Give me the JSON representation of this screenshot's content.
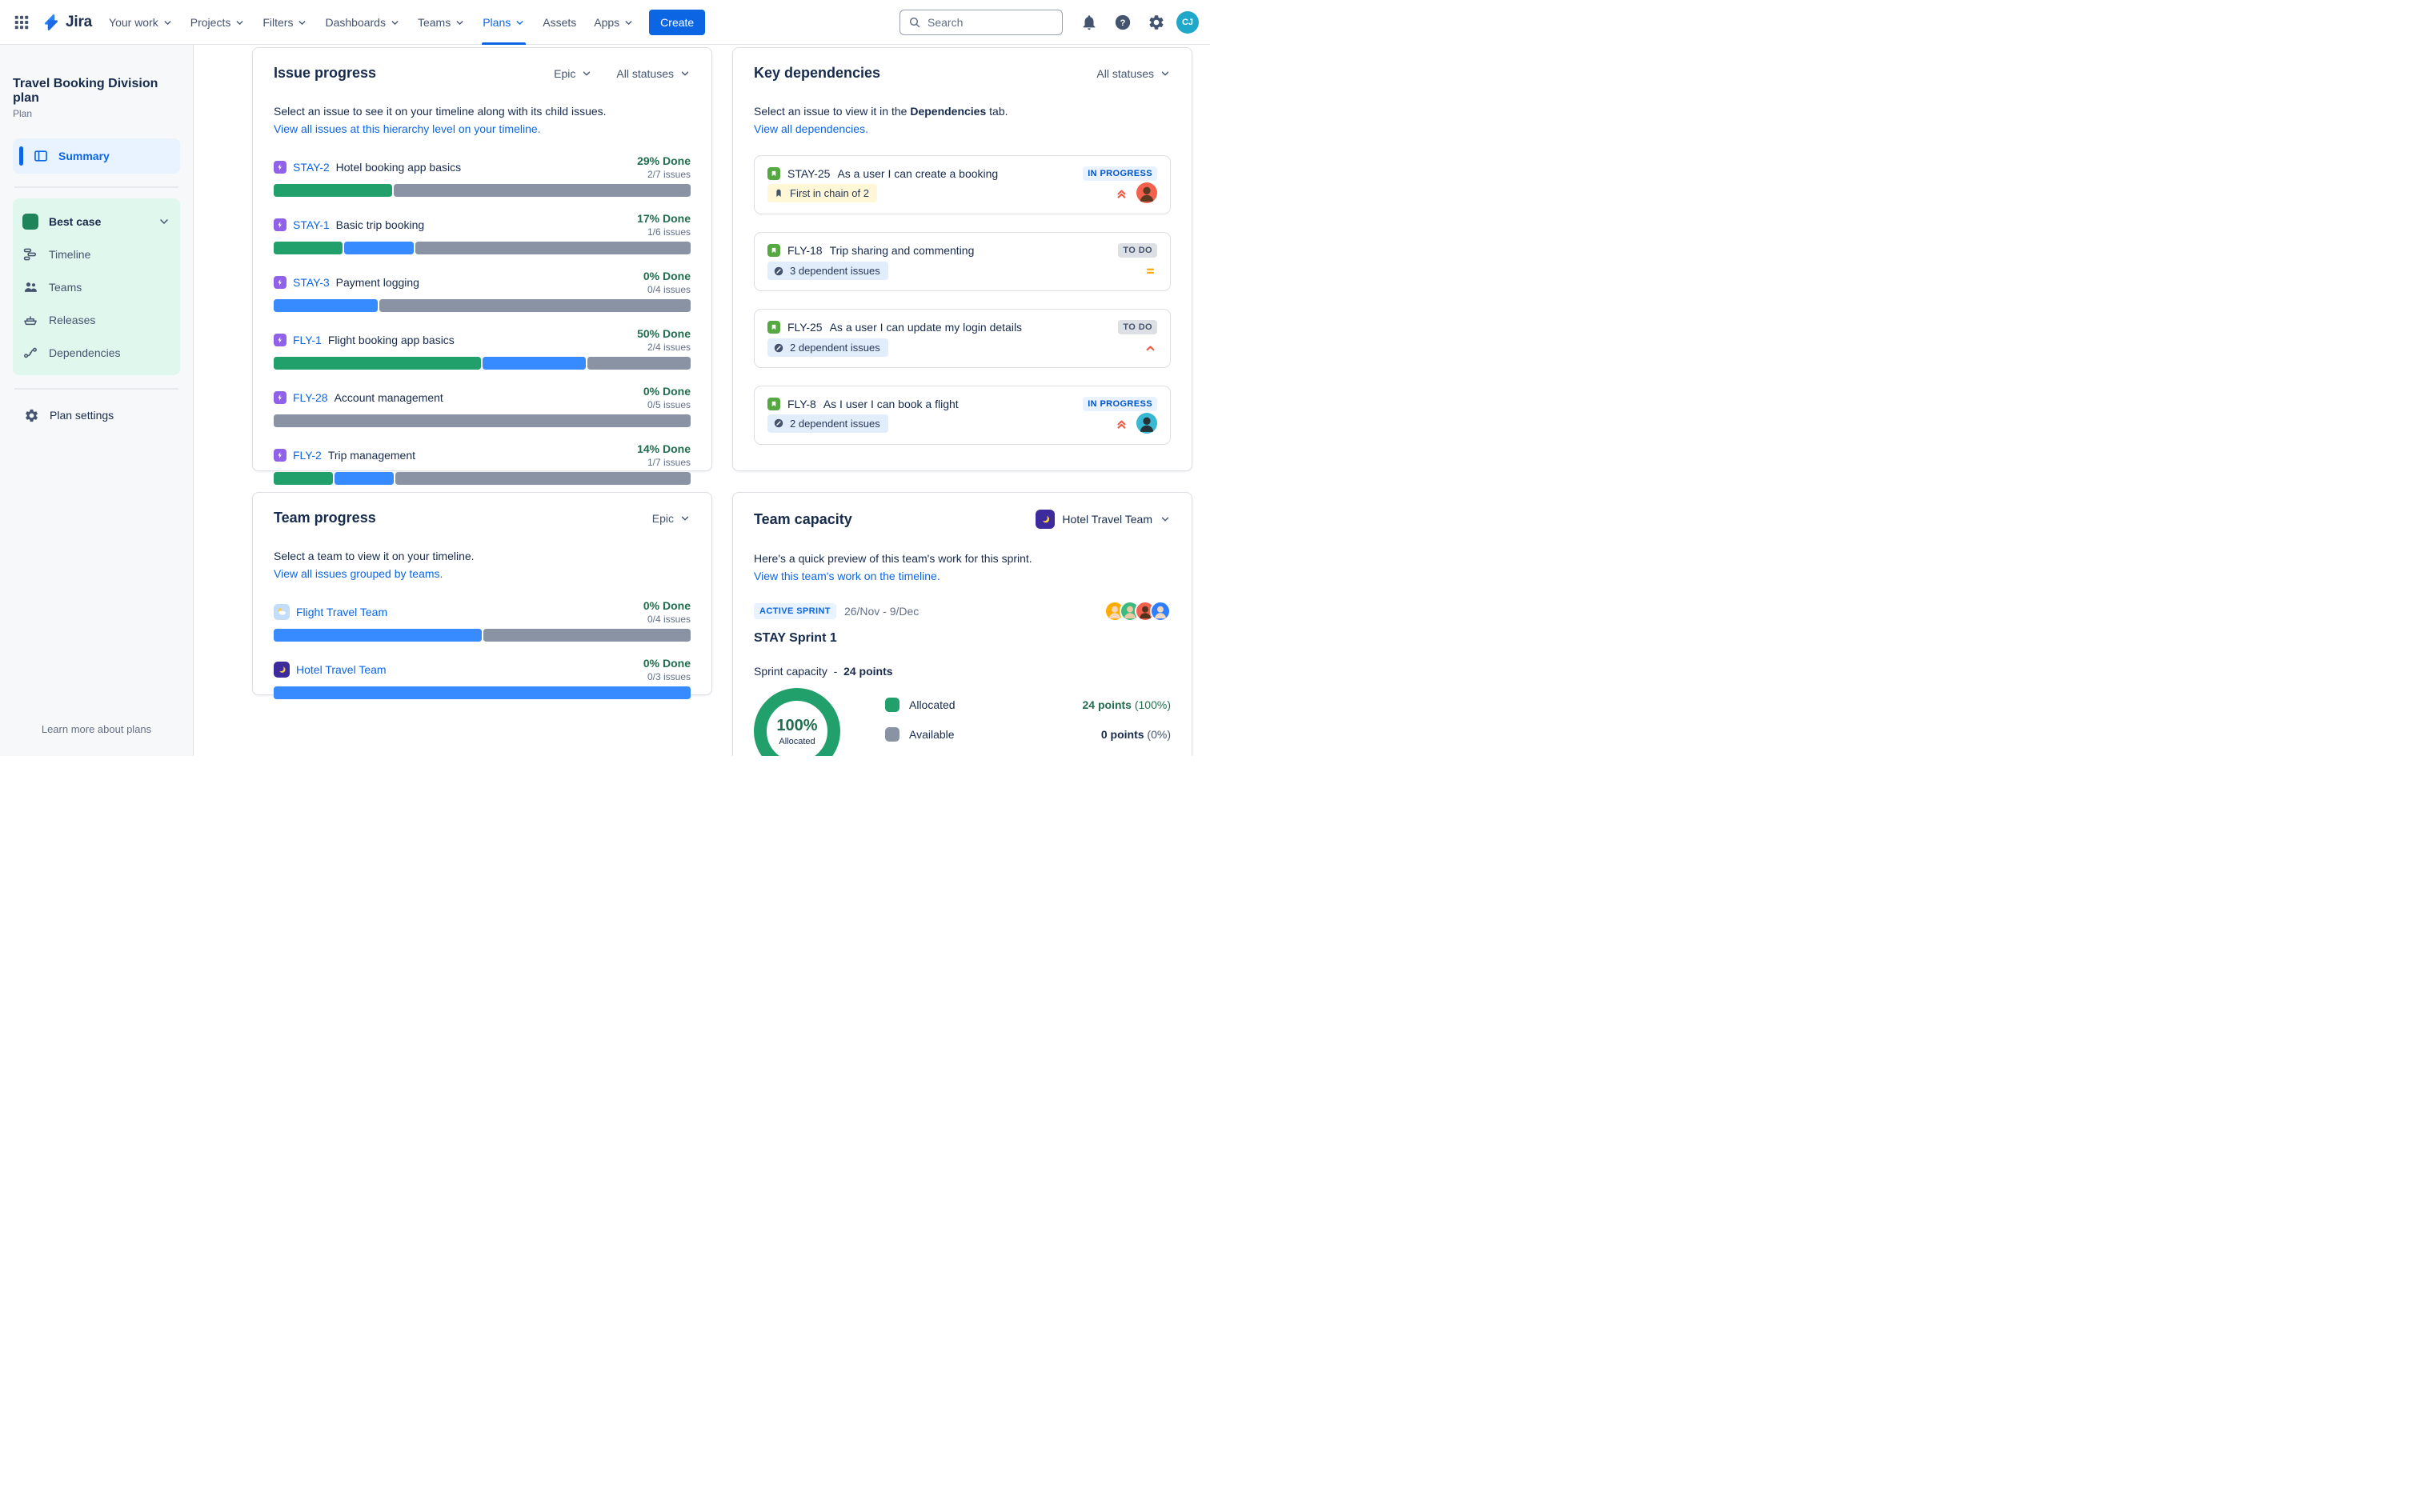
{
  "nav": {
    "logo_text": "Jira",
    "items": [
      {
        "label": "Your work",
        "chevron": true
      },
      {
        "label": "Projects",
        "chevron": true
      },
      {
        "label": "Filters",
        "chevron": true
      },
      {
        "label": "Dashboards",
        "chevron": true
      },
      {
        "label": "Teams",
        "chevron": true
      },
      {
        "label": "Plans",
        "chevron": true,
        "state": "active"
      },
      {
        "label": "Assets",
        "chevron": false
      },
      {
        "label": "Apps",
        "chevron": true
      }
    ],
    "create_label": "Create",
    "search_placeholder": "Search",
    "avatar_initials": "CJ"
  },
  "sidebar": {
    "plan_title": "Travel Booking Division plan",
    "plan_subtitle": "Plan",
    "summary_label": "Summary",
    "scenario_label": "Best case",
    "nav_items": [
      "Timeline",
      "Teams",
      "Releases",
      "Dependencies"
    ],
    "settings_label": "Plan settings",
    "footer_link": "Learn more about plans"
  },
  "issue_progress": {
    "title": "Issue progress",
    "hierarchy_filter": "Epic",
    "status_filter": "All statuses",
    "description": "Select an issue to see it on your timeline along with its child issues.",
    "link": "View all issues at this hierarchy level on your timeline.",
    "issues": [
      {
        "key": "STAY-2",
        "summary": "Hotel booking app basics",
        "done": "29% Done",
        "count": "2/7 issues",
        "segments": [
          {
            "color": "green",
            "pct": 28.6
          },
          {
            "color": "gray",
            "pct": 71.4
          }
        ]
      },
      {
        "key": "STAY-1",
        "summary": "Basic trip booking",
        "done": "17% Done",
        "count": "1/6 issues",
        "segments": [
          {
            "color": "green",
            "pct": 16.7
          },
          {
            "color": "blue",
            "pct": 16.7
          },
          {
            "color": "gray",
            "pct": 66.6
          }
        ]
      },
      {
        "key": "STAY-3",
        "summary": "Payment logging",
        "done": "0% Done",
        "count": "0/4 issues",
        "segments": [
          {
            "color": "blue",
            "pct": 25
          },
          {
            "color": "gray",
            "pct": 75
          }
        ]
      },
      {
        "key": "FLY-1",
        "summary": "Flight booking app basics",
        "done": "50% Done",
        "count": "2/4 issues",
        "segments": [
          {
            "color": "green",
            "pct": 50
          },
          {
            "color": "blue",
            "pct": 25
          },
          {
            "color": "gray",
            "pct": 25
          }
        ]
      },
      {
        "key": "FLY-28",
        "summary": "Account management",
        "done": "0% Done",
        "count": "0/5 issues",
        "segments": [
          {
            "color": "gray",
            "pct": 100
          }
        ]
      },
      {
        "key": "FLY-2",
        "summary": "Trip management",
        "done": "14% Done",
        "count": "1/7 issues",
        "segments": [
          {
            "color": "green",
            "pct": 14.3
          },
          {
            "color": "blue",
            "pct": 14.3
          },
          {
            "color": "gray",
            "pct": 71.4
          }
        ]
      }
    ]
  },
  "key_dependencies": {
    "title": "Key dependencies",
    "status_filter": "All statuses",
    "desc_prefix": "Select an issue to view it in the ",
    "desc_bold": "Dependencies",
    "desc_suffix": " tab.",
    "link": "View all dependencies.",
    "items": [
      {
        "key": "STAY-25",
        "summary": "As a user I can create a booking",
        "status": "IN PROGRESS",
        "status_class": "in-progress",
        "badge_label": "First in chain of 2",
        "badge_class": "chain",
        "badge_chain": true,
        "badge_deps": false,
        "prio_highest": true,
        "prio_high": false,
        "prio_medium": false,
        "avatar": "orange"
      },
      {
        "key": "FLY-18",
        "summary": "Trip sharing and commenting",
        "status": "TO DO",
        "status_class": "to-do",
        "badge_label": "3 dependent issues",
        "badge_class": "deps",
        "badge_chain": false,
        "badge_deps": true,
        "prio_highest": false,
        "prio_high": false,
        "prio_medium": true,
        "avatar": null
      },
      {
        "key": "FLY-25",
        "summary": "As a user I can update my login details",
        "status": "TO DO",
        "status_class": "to-do",
        "badge_label": "2 dependent issues",
        "badge_class": "deps",
        "badge_chain": false,
        "badge_deps": true,
        "prio_highest": false,
        "prio_high": true,
        "prio_medium": false,
        "avatar": null
      },
      {
        "key": "FLY-8",
        "summary": "As I user I can book a flight",
        "status": "IN PROGRESS",
        "status_class": "in-progress",
        "badge_label": "2 dependent issues",
        "badge_class": "deps",
        "badge_chain": false,
        "badge_deps": true,
        "prio_highest": true,
        "prio_high": false,
        "prio_medium": false,
        "avatar": "teal"
      }
    ]
  },
  "team_progress": {
    "title": "Team progress",
    "hierarchy_filter": "Epic",
    "description": "Select a team to view it on your timeline.",
    "link": "View all issues grouped by teams.",
    "teams": [
      {
        "name": "Flight Travel Team",
        "done": "0% Done",
        "count": "0/4 issues",
        "flight_icon": true,
        "hotel_icon": false,
        "segments": [
          {
            "color": "blue",
            "pct": 50
          },
          {
            "color": "gray",
            "pct": 50
          }
        ]
      },
      {
        "name": "Hotel Travel Team",
        "done": "0% Done",
        "count": "0/3 issues",
        "flight_icon": false,
        "hotel_icon": true,
        "segments": [
          {
            "color": "blue",
            "pct": 100
          }
        ]
      }
    ]
  },
  "team_capacity": {
    "title": "Team capacity",
    "team_selector": "Hotel Travel Team",
    "description": "Here's a quick preview of this team's work for this sprint.",
    "link": "View this team's work on the timeline.",
    "sprint_badge": "ACTIVE SPRINT",
    "date_range": "26/Nov - 9/Dec",
    "avatars": [
      {
        "bg": "yellow"
      },
      {
        "bg": "green"
      },
      {
        "bg": "red"
      },
      {
        "bg": "blue"
      }
    ],
    "sprint_name": "STAY Sprint 1",
    "capacity_label": "Sprint capacity",
    "capacity_sep": "-",
    "capacity_points": "24 points",
    "donut_percent": "100%",
    "donut_label": "Allocated",
    "legend": [
      {
        "label": "Allocated",
        "swatch": "green",
        "points": "24 points",
        "percent": " (100%)",
        "val_class": "green-text"
      },
      {
        "label": "Available",
        "swatch": "gray",
        "points": "0 points",
        "percent": " (0%)",
        "val_class": "dark-text"
      }
    ],
    "chart": {
      "type": "pie",
      "title": "Sprint capacity allocation",
      "slices": [
        {
          "label": "Allocated",
          "points": 24,
          "percent": 100,
          "color": "#22A06B"
        },
        {
          "label": "Available",
          "points": 0,
          "percent": 0,
          "color": "#8993A4"
        }
      ]
    }
  },
  "colors": {
    "accent_blue": "#0C66E4",
    "done_green": "#22A06B",
    "inprogress_blue": "#388BFF",
    "todo_gray": "#8993A4",
    "done_text_green": "#216E4E"
  }
}
